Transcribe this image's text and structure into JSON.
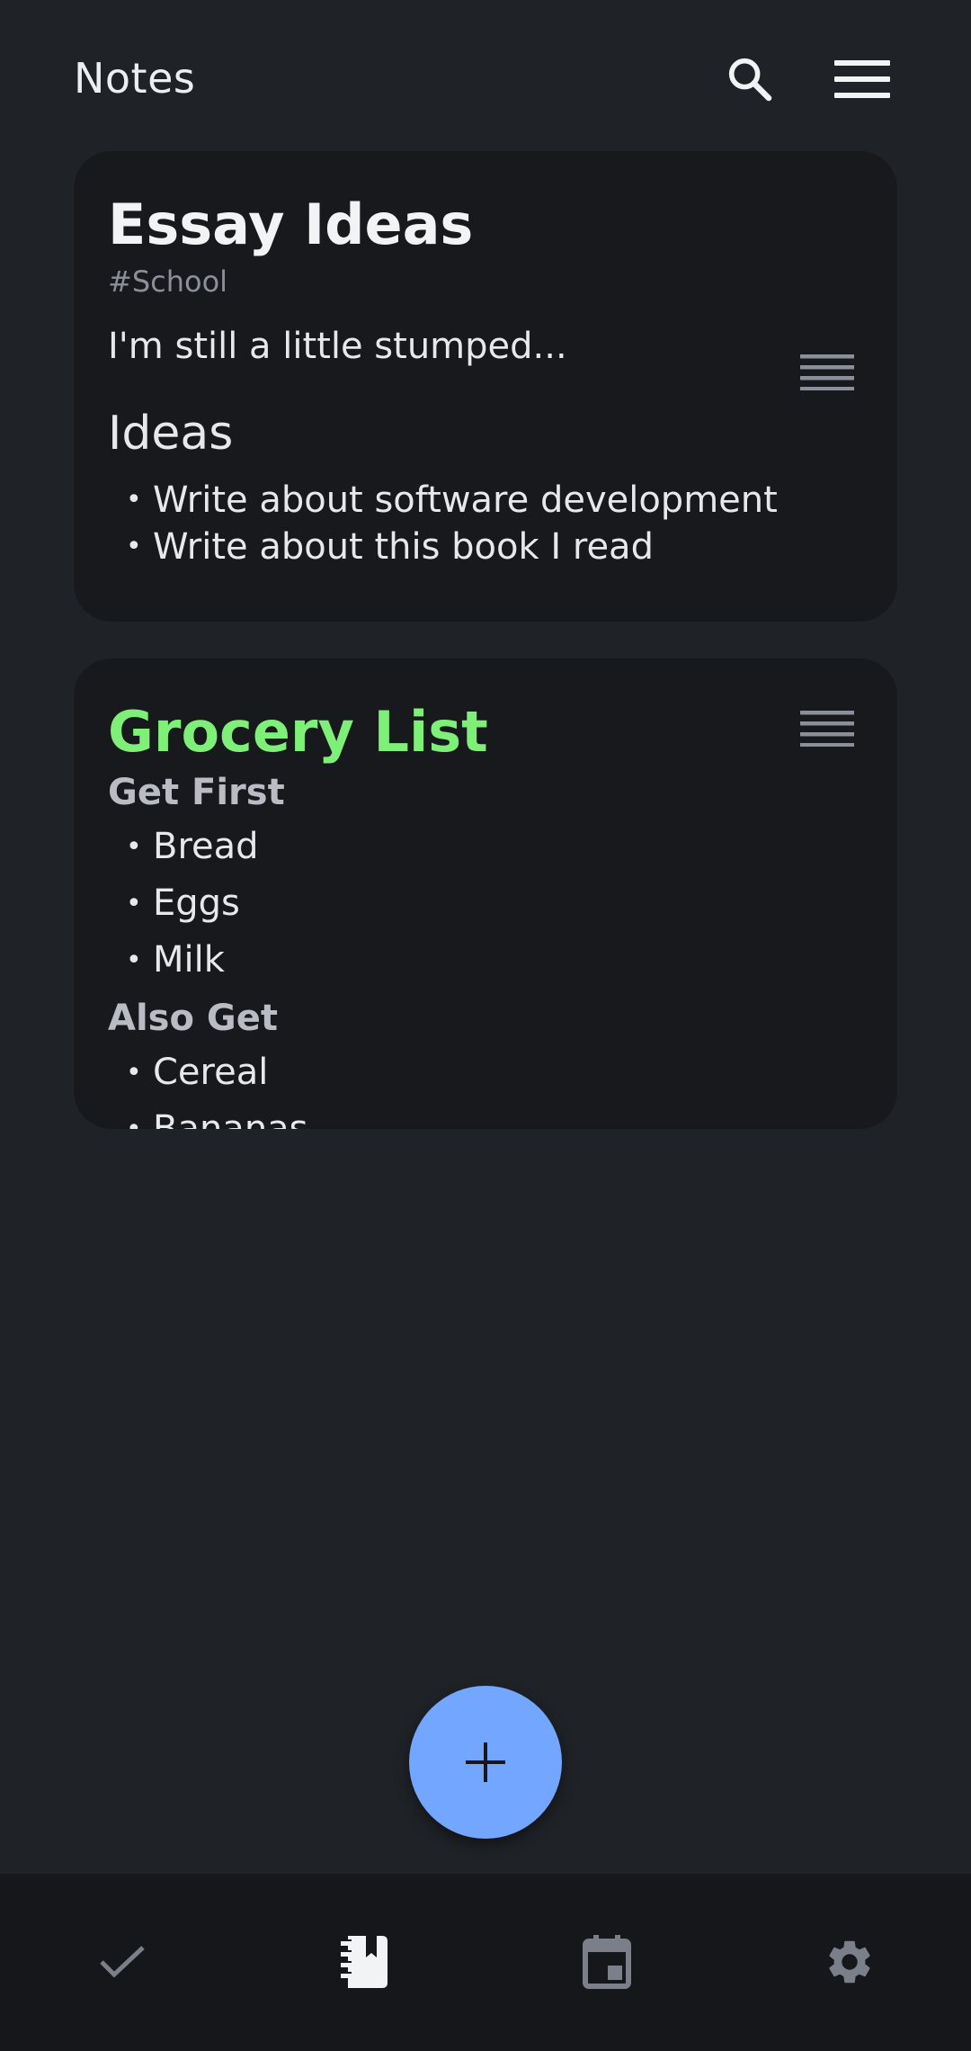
{
  "header": {
    "title": "Notes",
    "search_icon": "search-icon",
    "menu_icon": "hamburger-menu-icon"
  },
  "notes": [
    {
      "title": "Essay Ideas",
      "tag": "#School",
      "paragraph": "I'm still a little stumped...",
      "heading": "Ideas",
      "bullets": [
        "Write about software development",
        "Write about this book I read"
      ],
      "menu_icon": "note-menu-icon"
    },
    {
      "title": "Grocery List",
      "title_color": "#7ef078",
      "sections": [
        {
          "heading": "Get First",
          "items": [
            "Bread",
            "Eggs",
            "Milk"
          ]
        },
        {
          "heading": "Also Get",
          "items": [
            "Cereal",
            "Bananas"
          ]
        }
      ],
      "menu_icon": "note-menu-icon"
    }
  ],
  "fab": {
    "icon": "plus-icon",
    "color": "#72a6ff"
  },
  "bottom_nav": {
    "items": [
      {
        "name": "tasks",
        "icon": "check-icon",
        "active": false
      },
      {
        "name": "notes",
        "icon": "notebook-icon",
        "active": true
      },
      {
        "name": "calendar",
        "icon": "calendar-icon",
        "active": false
      },
      {
        "name": "settings",
        "icon": "gear-icon",
        "active": false
      }
    ]
  },
  "colors": {
    "background": "#1f2227",
    "card": "#18191d",
    "nav_background": "#16171a",
    "accent_green": "#7ef078",
    "accent_blue": "#72a6ff",
    "muted": "#8b8f99"
  }
}
